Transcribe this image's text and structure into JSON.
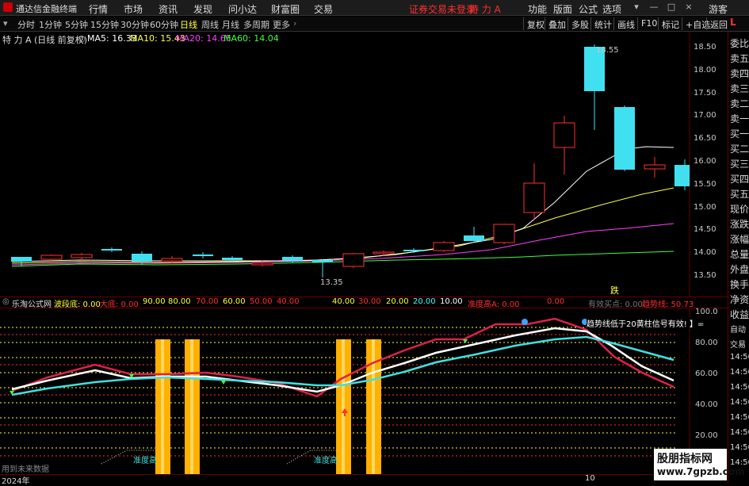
{
  "app": {
    "title": "通达信金融终端",
    "menu": [
      "行情",
      "市场",
      "资讯",
      "发现",
      "问小达",
      "财富圈",
      "交易"
    ],
    "login_status": "证券交易未登录",
    "stock_name": "特 力 A",
    "right_menu": [
      "功能",
      "版面",
      "公式",
      "选项"
    ],
    "guest": "游客"
  },
  "toolbar": {
    "periods": [
      "分时",
      "1分钟",
      "5分钟",
      "15分钟",
      "30分钟",
      "60分钟",
      "日线",
      "周线",
      "月线",
      "多周期",
      "更多"
    ],
    "active_period": "日线",
    "buttons": [
      "复权",
      "叠加",
      "多股",
      "统计",
      "画线",
      "F10",
      "标记",
      "+自选",
      "返回"
    ]
  },
  "main_chart": {
    "title": "特 力 A (日线 前复权)",
    "ma": [
      {
        "label": "MA5: 16.33",
        "color": "#ffffff"
      },
      {
        "label": "MA10: 15.43",
        "color": "#ffff40"
      },
      {
        "label": "MA20: 14.65",
        "color": "#ff40ff"
      },
      {
        "label": "MA60: 14.04",
        "color": "#40ff40"
      }
    ],
    "high_label": "18.55",
    "low_label": "13.35",
    "event_label": "跌",
    "y_ticks": [
      "18.50",
      "18.00",
      "17.50",
      "17.00",
      "16.50",
      "16.00",
      "15.50",
      "15.00",
      "14.50",
      "14.00",
      "13.50"
    ]
  },
  "sub_chart": {
    "name": "乐淘公式网",
    "items": [
      {
        "label": "波段底: 0.00",
        "color": "#ffff40"
      },
      {
        "label": "大底: 0.00",
        "color": "#ff3030"
      },
      {
        "label": "90.00",
        "color": "#ffff40"
      },
      {
        "label": "80.00",
        "color": "#ffff40"
      },
      {
        "label": "70.00",
        "color": "#ff3030"
      },
      {
        "label": "60.00",
        "color": "#ffff40"
      },
      {
        "label": "50.00",
        "color": "#ff3030"
      },
      {
        "label": "40.00",
        "color": "#ff3030"
      },
      {
        "label": "40.00",
        "color": "#ffff40"
      },
      {
        "label": "30.00",
        "color": "#ff3030"
      },
      {
        "label": "20.00",
        "color": "#ffff40"
      },
      {
        "label": "20.00",
        "color": "#40ffff"
      },
      {
        "label": "10.00",
        "color": "#ffffff"
      },
      {
        "label": "准度高A: 0.00",
        "color": "#ff3030"
      },
      {
        "label": "0.00",
        "color": "#ff3030"
      },
      {
        "label": "有效买点: 0.00",
        "color": "#777777"
      },
      {
        "label": "趋势线: 50.73",
        "color": "#ff3030"
      }
    ],
    "y_ticks": [
      "100.0",
      "80.00",
      "60.00",
      "40.00",
      "20.00"
    ],
    "note": "趋势线低于20黄柱信号有效! 】=",
    "label_a": "准度高",
    "label_b": "准度高",
    "future_data": "用到未来数据"
  },
  "right_panel": {
    "top": "L",
    "items": [
      "委比",
      "卖五",
      "卖四",
      "卖三",
      "卖二",
      "卖一",
      "买一",
      "买二",
      "买三",
      "买四",
      "买五",
      "现价",
      "涨跌",
      "涨幅",
      "总量",
      "外盘",
      "换手",
      "净资",
      "收益",
      "自动",
      "交易",
      "14:56",
      "14:56",
      "14:56",
      "14:56",
      "14:56",
      "14:56",
      "14:56",
      "14:56"
    ]
  },
  "bottom": {
    "year": "2024年",
    "marker": "10"
  },
  "watermark": {
    "line1": "股朋指标网",
    "line2": "www.7gpzb.com"
  }
}
